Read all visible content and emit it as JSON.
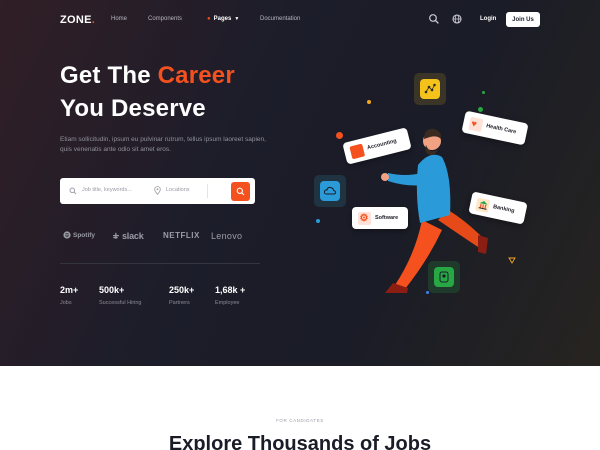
{
  "nav": {
    "logo": "ZONE",
    "logo_dot": ".",
    "links": [
      {
        "label": "Home"
      },
      {
        "label": "Components"
      },
      {
        "label": "Pages"
      },
      {
        "label": "Documentation"
      }
    ],
    "active_index": 2,
    "login": "Login",
    "join": "Join Us"
  },
  "hero": {
    "title_line1_prefix": "Get The ",
    "title_line1_accent": "Career",
    "title_line2": "You Deserve",
    "description": "Etiam sollicitudin, ipsum eu pulvinar rutrum, tellus ipsum laoreet sapien, quis venenatis ante odio sit amet eros.",
    "search": {
      "job_placeholder": "Job title, keywords...",
      "location_placeholder": "Locations"
    },
    "brands": [
      "Spotify",
      "slack",
      "NETFLIX",
      "Lenovo"
    ],
    "stats": [
      {
        "value": "2m+",
        "label": "Jobs"
      },
      {
        "value": "500k+",
        "label": "Successful Hiring"
      },
      {
        "value": "250k+",
        "label": "Partners"
      },
      {
        "value": "1,68k +",
        "label": "Employee"
      }
    ],
    "cards": {
      "accounting": "Accounting",
      "health": "Health Care",
      "software": "Software",
      "banking": "Banking"
    }
  },
  "section": {
    "eyebrow": "FOR CANDIDATES",
    "title": "Explore Thousands of Jobs"
  },
  "colors": {
    "accent": "#f4511e",
    "hero_bg": "#1d1d2a"
  }
}
